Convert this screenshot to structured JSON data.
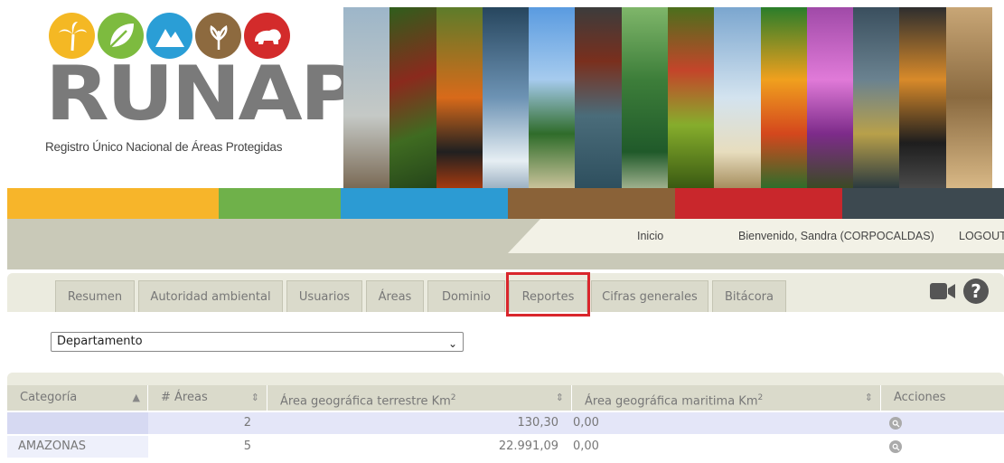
{
  "header": {
    "logo_text": "RUNAP",
    "subtitle": "Registro Único Nacional de Áreas Protegidas",
    "circle_icons": [
      "palm-icon",
      "leaf-icon",
      "mountain-icon",
      "plant-icon",
      "bear-icon"
    ],
    "circle_colors": [
      "#f4b824",
      "#7dbb3f",
      "#2a9ed6",
      "#8d6a3f",
      "#d32b2b"
    ],
    "colorbar": [
      "#f7b52a",
      "#6fb14a",
      "#2c9bd3",
      "#8a6238",
      "#c9272c",
      "#3d4950"
    ]
  },
  "userbar": {
    "home": "Inicio",
    "welcome": "Bienvenido, Sandra (CORPOCALDAS)",
    "logout": "LOGOUT"
  },
  "tabs": [
    {
      "label": "Resumen"
    },
    {
      "label": "Autoridad ambiental"
    },
    {
      "label": "Usuarios"
    },
    {
      "label": "Áreas"
    },
    {
      "label": "Dominio"
    },
    {
      "label": "Reportes"
    },
    {
      "label": "Cifras generales"
    },
    {
      "label": "Bitácora"
    }
  ],
  "filter": {
    "selected": "Departamento"
  },
  "table": {
    "columns": {
      "categoria": "Categoría",
      "areas": "# Áreas",
      "terrestre": "Área geográfica terrestre Km",
      "maritima": "Área geográfica maritima Km",
      "sup": "2",
      "acciones": "Acciones"
    },
    "rows": [
      {
        "categoria": "",
        "areas": "2",
        "terrestre": "130,30",
        "maritima": "0,00"
      },
      {
        "categoria": "AMAZONAS",
        "areas": "5",
        "terrestre": "22.991,09",
        "maritima": "0,00"
      }
    ]
  }
}
